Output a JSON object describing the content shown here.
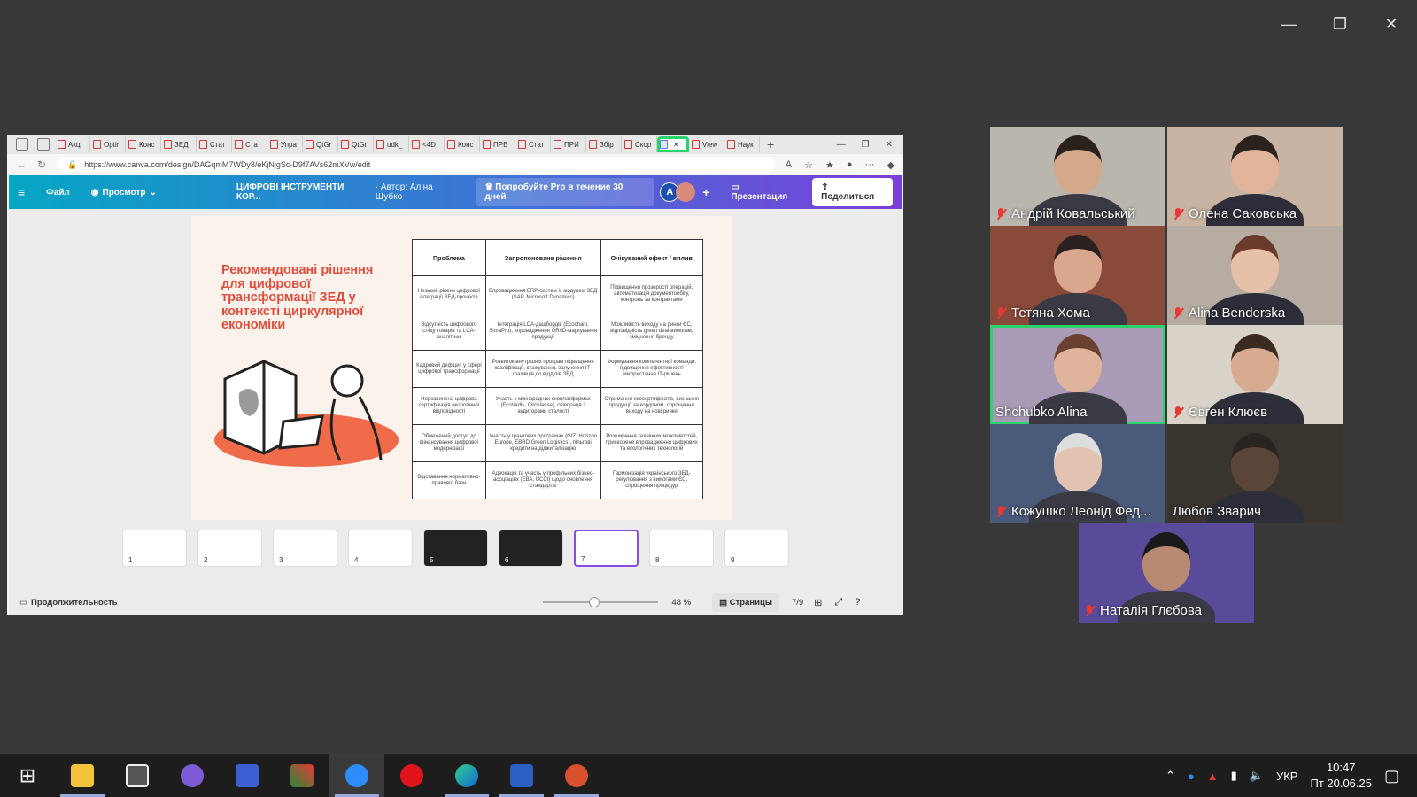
{
  "browser": {
    "tabs": [
      "Акці",
      "Optir",
      "Конс",
      "ЗЕД",
      "Стат",
      "Стат",
      "Упра",
      "QtGr",
      "QtGr",
      "udk_",
      "<4D",
      "Конс",
      "ПРЕ",
      "Стат",
      "ПРИ",
      "Збір",
      "Скор",
      "",
      "View",
      "Наук"
    ],
    "url": "https://www.canva.com/design/DAGqmM7WDy8/eKjNjgSc-D9f7AVs62mXVw/edit"
  },
  "canva": {
    "file": "Файл",
    "view": "Просмотр",
    "doc_title": "ЦИФРОВІ ІНСТРУМЕНТИ КОР...",
    "author": "· Автор: Аліна Щубко",
    "pro_offer": "Попробуйте Pro в течение 30 дней",
    "avatar_letter": "A",
    "present": "Презентация",
    "share": "Поделиться"
  },
  "slide": {
    "title": "Рекомендовані рішення для цифрової трансформації ЗЕД у контексті циркулярної економіки",
    "headers": [
      "Проблема",
      "Запропоноване рішення",
      "Очікуваний ефект / вплив"
    ],
    "rows": [
      [
        "Низький рівень цифрової інтеграції ЗЕД-процесів",
        "Впровадження ERP-систем із модулем ЗЕД (SAP, Microsoft Dynamics)",
        "Підвищення прозорості операцій, автоматизація документообігу, контроль за контрактами"
      ],
      [
        "Відсутність цифрового сліду товарів та LCA-аналітики",
        "Інтеграція LCA-дашбордів (Ecochain, SimaPro), впровадження QR/ID-маркування продукції",
        "Можливість виходу на ринки ЄС, відповідність green deal-вимогам, зміцнення бренду"
      ],
      [
        "Кадровий дефіцит у сфері цифрової трансформації",
        "Розвиток внутрішніх програм підвищення кваліфікації, стажування, залучення IT-фахівців до відділів ЗЕД",
        "Формування компетентної команди, підвищення ефективності використання IT-рішень"
      ],
      [
        "Нерозвинена цифрова сертифікація екологічної відповідності",
        "Участь у міжнародних екоплатформах (EcoVadis, Circularise), співпраця з аудиторами сталості",
        "Отримання екосертифікатів, визнання продукції за кордоном, спрощення виходу на нові ринки"
      ],
      [
        "Обмежений доступ до фінансування цифрової модернізації",
        "Участь у грантових програмах (GIZ, Horizon Europe, EBRD Green Logistics), пільгові кредити на діджиталізацію",
        "Розширення технічних можливостей, прискорене впровадження цифрових та екологічних технологій"
      ],
      [
        "Відставання нормативно-правової бази",
        "Адвокація та участь у профільних бізнес-асоціаціях (ЕВА, UCCI) щодо оновлення стандартів",
        "Гармонізація українського ЗЕД-регулювання з вимогами ЄС, спрощення процедур"
      ]
    ]
  },
  "thumbs": [
    "1",
    "2",
    "3",
    "4",
    "5",
    "6",
    "7",
    "8",
    "9"
  ],
  "bottom": {
    "duration": "Продолжительность",
    "zoom": "48 %",
    "pages": "Страницы",
    "page_num": "7/9"
  },
  "participants": [
    "Андрій Ковальський",
    "Олена Саковська",
    "Тетяна Хома",
    "Alina Benderska",
    "Shchubko Alina",
    "Євген Клюєв",
    "Кожушко Леонід Фед...",
    "Любов Зварич",
    "Наталія Глєбова"
  ],
  "taskbar": {
    "lang": "УКР",
    "time": "10:47",
    "date": "Пт 20.06.25"
  },
  "colors": {
    "accent": "#e24d3b",
    "canva_start": "#06a6c4",
    "canva_end": "#7b3fd8",
    "active_speaker": "#2bd46a"
  }
}
